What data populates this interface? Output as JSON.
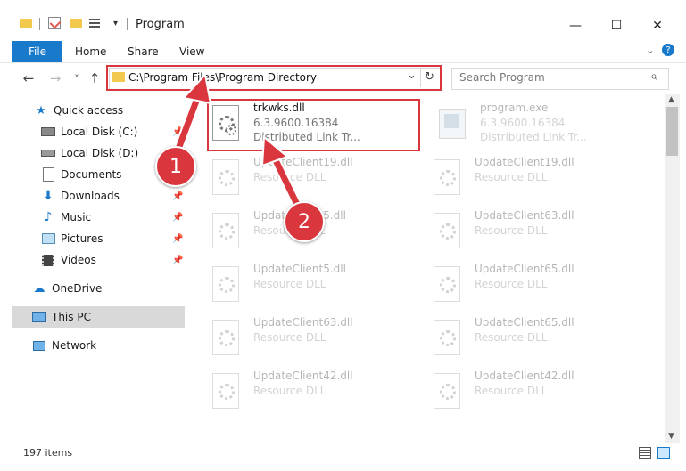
{
  "window": {
    "title": "Program",
    "minimize": "—",
    "maximize": "☐",
    "close": "✕"
  },
  "ribbon": {
    "tabs": [
      "File",
      "Home",
      "Share",
      "View"
    ],
    "help": "?"
  },
  "address": {
    "path": "C:\\Program Files\\Program Directory",
    "back": "←",
    "forward": "→",
    "recent": "˅",
    "up": "↑",
    "dropdown": "⌄",
    "refresh": "↻"
  },
  "search": {
    "placeholder": "Search Program",
    "icon": "⌕"
  },
  "nav": {
    "quick_access": "Quick access",
    "local_c": "Local Disk (C:)",
    "local_d": "Local Disk (D:)",
    "documents": "Documents",
    "downloads": "Downloads",
    "music": "Music",
    "pictures": "Pictures",
    "videos": "Videos",
    "onedrive": "OneDrive",
    "this_pc": "This PC",
    "network": "Network"
  },
  "files": {
    "trkwks": {
      "name": "trkwks.dll",
      "version": "6.3.9600.16384",
      "desc": "Distributed Link Tr..."
    },
    "program": {
      "name": "program.exe",
      "version": "6.3.9600.16384",
      "desc": "Distributed Link Tr..."
    },
    "f1": {
      "name": "UpdateClient19.dll",
      "type": "Resource DLL"
    },
    "f2": {
      "name": "UpdateClient19.dll",
      "type": "Resource DLL"
    },
    "f3": {
      "name": "UpdateClient5.dll",
      "type": "Resource DLL"
    },
    "f4": {
      "name": "UpdateClient63.dll",
      "type": "Resource DLL"
    },
    "f5": {
      "name": "UpdateClient5.dll",
      "type": "Resource DLL"
    },
    "f6": {
      "name": "UpdateClient65.dll",
      "type": "Resource DLL"
    },
    "f7": {
      "name": "UpdateClient63.dll",
      "type": "Resource DLL"
    },
    "f8": {
      "name": "UpdateClient65.dll",
      "type": "Resource DLL"
    },
    "f9": {
      "name": "UpdateClient42.dll",
      "type": "Resource DLL"
    },
    "f10": {
      "name": "UpdateClient42.dll",
      "type": "Resource DLL"
    }
  },
  "status": {
    "count": "197 items"
  },
  "annotations": {
    "step1": "1",
    "step2": "2"
  },
  "colors": {
    "accent": "#1979ca",
    "highlight_red": "#d9363e",
    "selected_nav": "#cce8ff"
  }
}
